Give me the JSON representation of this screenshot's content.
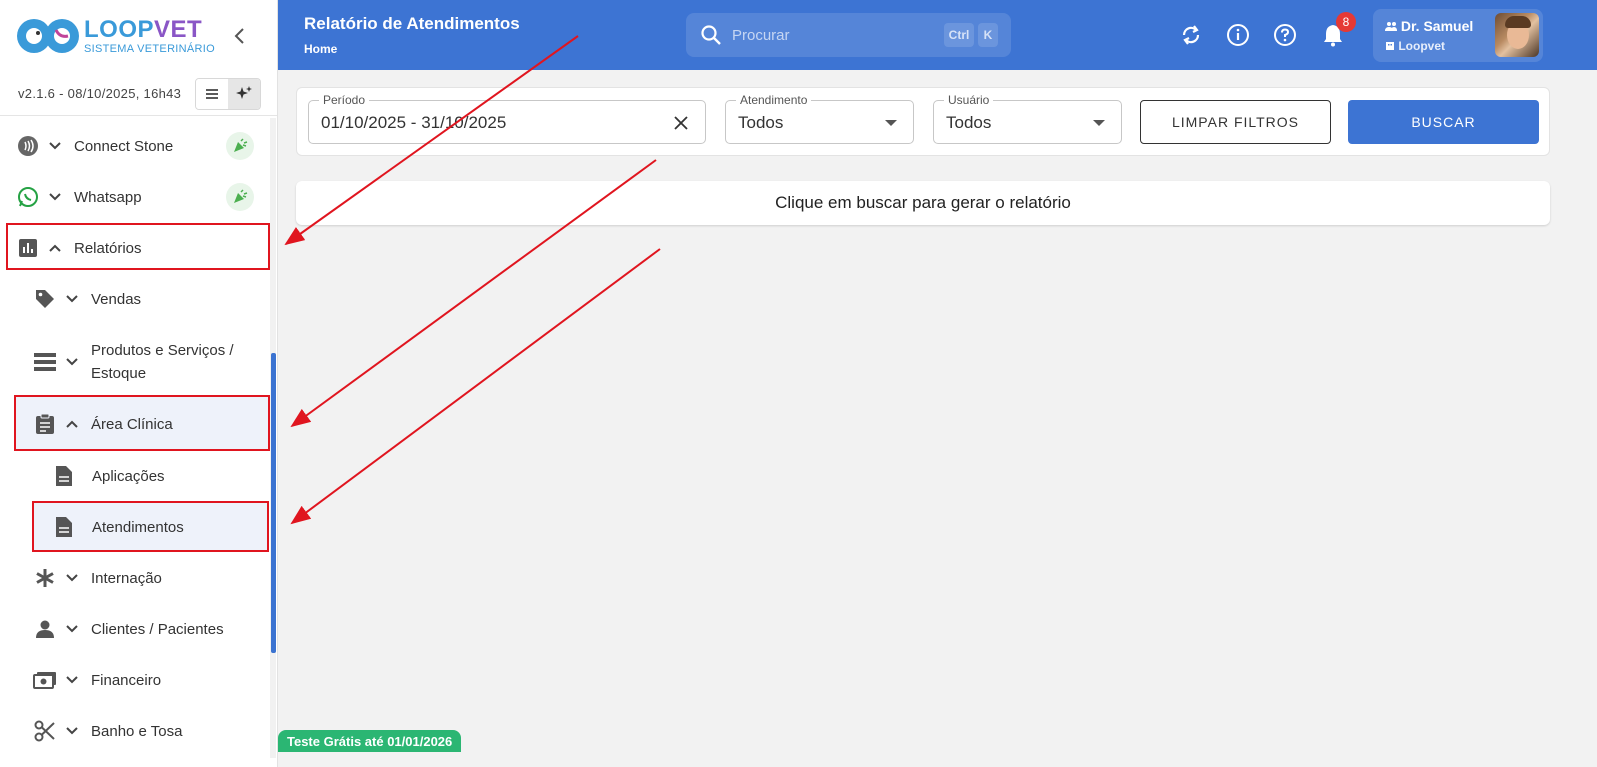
{
  "brand": {
    "name_part1": "LOOP",
    "name_part2": "VET",
    "subtitle": "SISTEMA VETERINÁRIO"
  },
  "version": "v2.1.6 - 08/10/2025, 16h43",
  "sidebar": {
    "items": [
      {
        "label": "Connect Stone",
        "icon": "contactless-icon"
      },
      {
        "label": "Whatsapp",
        "icon": "whatsapp-icon"
      },
      {
        "label": "Relatórios",
        "icon": "bar-chart-icon"
      },
      {
        "label": "Vendas",
        "icon": "tag-icon"
      },
      {
        "label": "Produtos e Serviços /",
        "label2": "Estoque",
        "icon": "storage-icon"
      },
      {
        "label": "Área Clínica",
        "icon": "clipboard-icon"
      },
      {
        "label": "Aplicações",
        "icon": "document-icon"
      },
      {
        "label": "Atendimentos",
        "icon": "document-icon"
      },
      {
        "label": "Internação",
        "icon": "asterisk-icon"
      },
      {
        "label": "Clientes / Pacientes",
        "icon": "person-icon"
      },
      {
        "label": "Financeiro",
        "icon": "cash-icon"
      },
      {
        "label": "Banho e Tosa",
        "icon": "scissors-icon"
      }
    ]
  },
  "header": {
    "title": "Relatório de Atendimentos",
    "breadcrumb": "Home",
    "search_placeholder": "Procurar",
    "shortcut_ctrl": "Ctrl",
    "shortcut_k": "K",
    "notification_count": "8",
    "user_name": "Dr. Samuel",
    "user_org": "Loopvet"
  },
  "filters": {
    "period_label": "Período",
    "period_value": "01/10/2025 - 31/10/2025",
    "attendance_label": "Atendimento",
    "attendance_value": "Todos",
    "user_label": "Usuário",
    "user_value": "Todos",
    "clear_label": "LIMPAR FILTROS",
    "search_label": "BUSCAR"
  },
  "empty_message": "Clique em buscar para gerar o relatório",
  "trial_banner": "Teste Grátis até 01/01/2026",
  "colors": {
    "primary": "#3d74d3",
    "annotation_red": "#e0151f",
    "trial_green": "#2bb673"
  }
}
